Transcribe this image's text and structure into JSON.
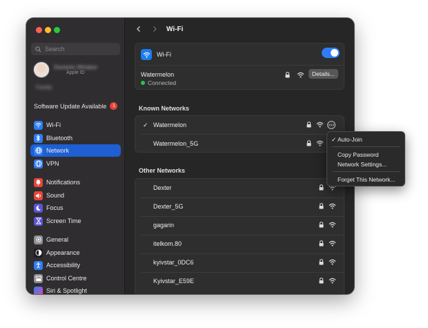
{
  "window": {
    "title": "Wi-Fi"
  },
  "search": {
    "placeholder": "Search"
  },
  "account": {
    "name": "Domenic Windsor",
    "subtitle": "Apple ID",
    "family": "Family"
  },
  "update": {
    "label": "Software Update Available",
    "count": "1"
  },
  "sidebar": {
    "items": [
      {
        "label": "Wi-Fi",
        "icon": "wifi-icon",
        "color": "#2f7df6"
      },
      {
        "label": "Bluetooth",
        "icon": "bluetooth-icon",
        "color": "#2f7df6"
      },
      {
        "label": "Network",
        "icon": "globe-icon",
        "color": "#2f7df6",
        "active": true
      },
      {
        "label": "VPN",
        "icon": "vpn-globe-icon",
        "color": "#2f7df6"
      },
      {
        "label": "Notifications",
        "icon": "bell-icon",
        "color": "#e8443a"
      },
      {
        "label": "Sound",
        "icon": "speaker-icon",
        "color": "#e8443a"
      },
      {
        "label": "Focus",
        "icon": "moon-icon",
        "color": "#5b54d6"
      },
      {
        "label": "Screen Time",
        "icon": "hourglass-icon",
        "color": "#5b54d6"
      },
      {
        "label": "General",
        "icon": "gear-icon",
        "color": "#8e8e93"
      },
      {
        "label": "Appearance",
        "icon": "appearance-icon",
        "color": "#1c1c1e"
      },
      {
        "label": "Accessibility",
        "icon": "accessibility-icon",
        "color": "#2f7df6"
      },
      {
        "label": "Control Centre",
        "icon": "control-centre-icon",
        "color": "#8e8e93"
      },
      {
        "label": "Siri & Spotlight",
        "icon": "siri-icon",
        "color": "#b04bd6"
      }
    ]
  },
  "wifi": {
    "label": "Wi-Fi",
    "enabled": true,
    "current_network": "Watermelon",
    "status": "Connected",
    "details_label": "Details..."
  },
  "known": {
    "title": "Known Networks",
    "networks": [
      {
        "name": "Watermelon",
        "checked": true
      },
      {
        "name": "Watermelon_5G",
        "checked": false
      }
    ]
  },
  "other": {
    "title": "Other Networks",
    "networks": [
      {
        "name": "Dexter"
      },
      {
        "name": "Dexter_5G"
      },
      {
        "name": "gagarin"
      },
      {
        "name": "itelkom.80"
      },
      {
        "name": "kyivstar_0DC6"
      },
      {
        "name": "Kyivstar_E59E"
      }
    ]
  },
  "context_menu": {
    "items": [
      "Auto-Join",
      "Copy Password",
      "Network Settings...",
      "Forget This Network..."
    ],
    "checked": "Auto-Join"
  },
  "colors": {
    "accent": "#1e5fd3",
    "toggle": "#2f7df6",
    "connected": "#2fc14a"
  }
}
